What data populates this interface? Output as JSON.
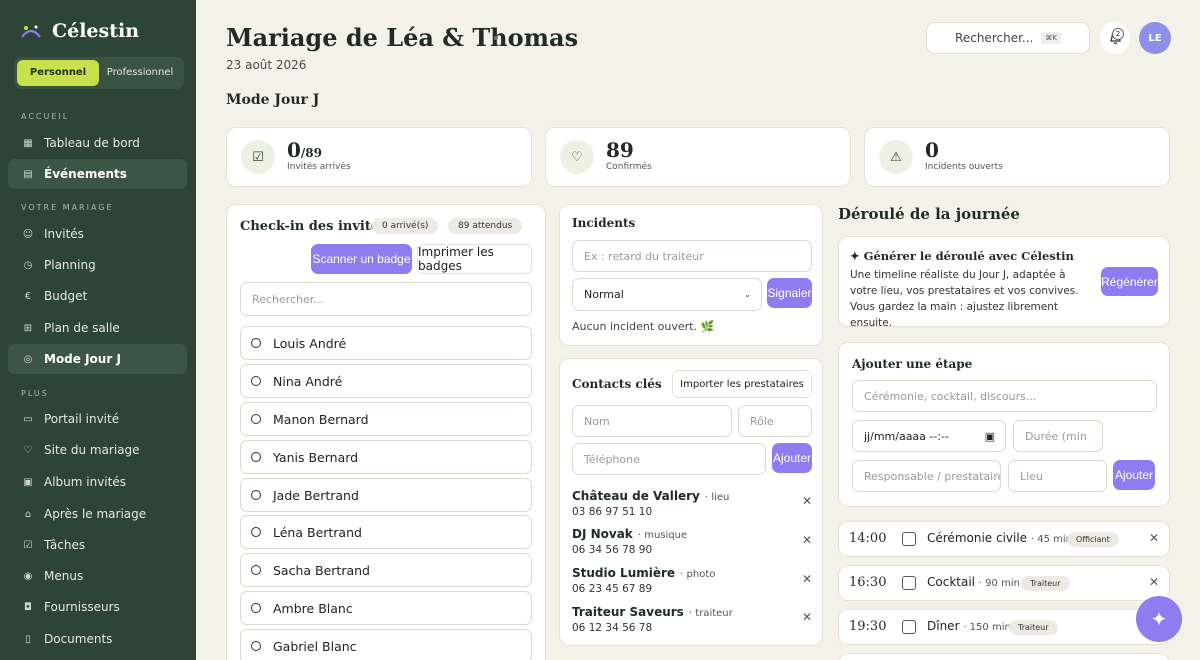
{
  "brand": {
    "name": "Célestin"
  },
  "mode_toggle": {
    "personal": "Personnel",
    "pro": "Professionnel"
  },
  "sidebar": {
    "section_home": "ACCUEIL",
    "section_wedding": "VOTRE MARIAGE",
    "section_more": "PLUS",
    "items": [
      {
        "label": "Tableau de bord",
        "icon": "grid-icon"
      },
      {
        "label": "Événements",
        "icon": "calendar-icon"
      },
      {
        "label": "Invités",
        "icon": "users-icon"
      },
      {
        "label": "Planning",
        "icon": "clock-icon"
      },
      {
        "label": "Budget",
        "icon": "euro-icon"
      },
      {
        "label": "Plan de salle",
        "icon": "table-icon"
      },
      {
        "label": "Mode Jour J",
        "icon": "target-icon"
      },
      {
        "label": "Portail invité",
        "icon": "portal-icon"
      },
      {
        "label": "Site du mariage",
        "icon": "heart-icon"
      },
      {
        "label": "Album invités",
        "icon": "image-icon"
      },
      {
        "label": "Après le mariage",
        "icon": "gift-icon"
      },
      {
        "label": "Tâches",
        "icon": "check-icon"
      },
      {
        "label": "Menus",
        "icon": "menu-icon"
      },
      {
        "label": "Fournisseurs",
        "icon": "briefcase-icon"
      },
      {
        "label": "Documents",
        "icon": "file-icon"
      }
    ]
  },
  "header": {
    "title": "Mariage de Léa & Thomas",
    "date": "23 août 2026",
    "section": "Mode Jour J",
    "search_label": "Rechercher...",
    "search_shortcut": "⌘K",
    "notif_count": "2",
    "avatar": "LE"
  },
  "stats": [
    {
      "value": "0",
      "suffix": "/89",
      "label": "Invités arrivés",
      "icon": "check-square-icon"
    },
    {
      "value": "89",
      "suffix": "",
      "label": "Confirmés",
      "icon": "heart-icon"
    },
    {
      "value": "0",
      "suffix": "",
      "label": "Incidents ouverts",
      "icon": "warning-icon"
    }
  ],
  "checkin": {
    "title": "Check-in des invités",
    "arrived": "0 arrivé(s)",
    "expected": "89 attendus",
    "scan": "Scanner un badge",
    "print": "Imprimer les badges",
    "search_placeholder": "Rechercher...",
    "guests": [
      "Louis André",
      "Nina André",
      "Manon Bernard",
      "Yanis Bernard",
      "Jade Bertrand",
      "Léna Bertrand",
      "Sacha Bertrand",
      "Ambre Blanc",
      "Gabriel Blanc"
    ]
  },
  "incidents": {
    "title": "Incidents",
    "placeholder": "Ex : retard du traiteur",
    "priority": "Normal",
    "submit": "Signaler",
    "empty": "Aucun incident ouvert. 🌿"
  },
  "contacts": {
    "title": "Contacts clés",
    "import": "Importer les prestataires",
    "name_ph": "Nom",
    "role_ph": "Rôle",
    "phone_ph": "Téléphone",
    "add": "Ajouter",
    "list": [
      {
        "name": "Château de Vallery",
        "role": "· lieu",
        "phone": "03 86 97 51 10"
      },
      {
        "name": "DJ Novak",
        "role": "· musique",
        "phone": "06 34 56 78 90"
      },
      {
        "name": "Studio Lumière",
        "role": "· photo",
        "phone": "06 23 45 67 89"
      },
      {
        "name": "Traiteur Saveurs",
        "role": "· traiteur",
        "phone": "06 12 34 56 78"
      }
    ]
  },
  "timeline": {
    "title": "Déroulé de la journée",
    "gen_title": "✦ Générer le déroulé avec Célestin",
    "gen_text": "Une timeline réaliste du Jour J, adaptée à votre lieu, vos prestataires et vos convives. Vous gardez la main : ajustez librement ensuite.",
    "regen": "Régénérer",
    "add_title": "Ajouter une étape",
    "step_ph": "Cérémonie, cocktail, discours...",
    "date_ph": "jj/mm/aaaa --:--",
    "dur_ph": "Durée (min",
    "resp_ph": "Responsable / prestataire",
    "place_ph": "Lieu",
    "add": "Ajouter",
    "steps": [
      {
        "time": "14:00",
        "label": "Cérémonie civile",
        "dur": "· 45 min",
        "tag": "Officiant"
      },
      {
        "time": "16:30",
        "label": "Cocktail",
        "dur": "· 90 min",
        "tag": "Traiteur"
      },
      {
        "time": "19:30",
        "label": "Dîner",
        "dur": "· 150 min",
        "tag": "Traiteur"
      }
    ]
  },
  "colors": {
    "sidebar": "#2d4536",
    "accent": "#8e7cf0",
    "lime": "#c8e04b",
    "bg": "#f4f1e9"
  }
}
